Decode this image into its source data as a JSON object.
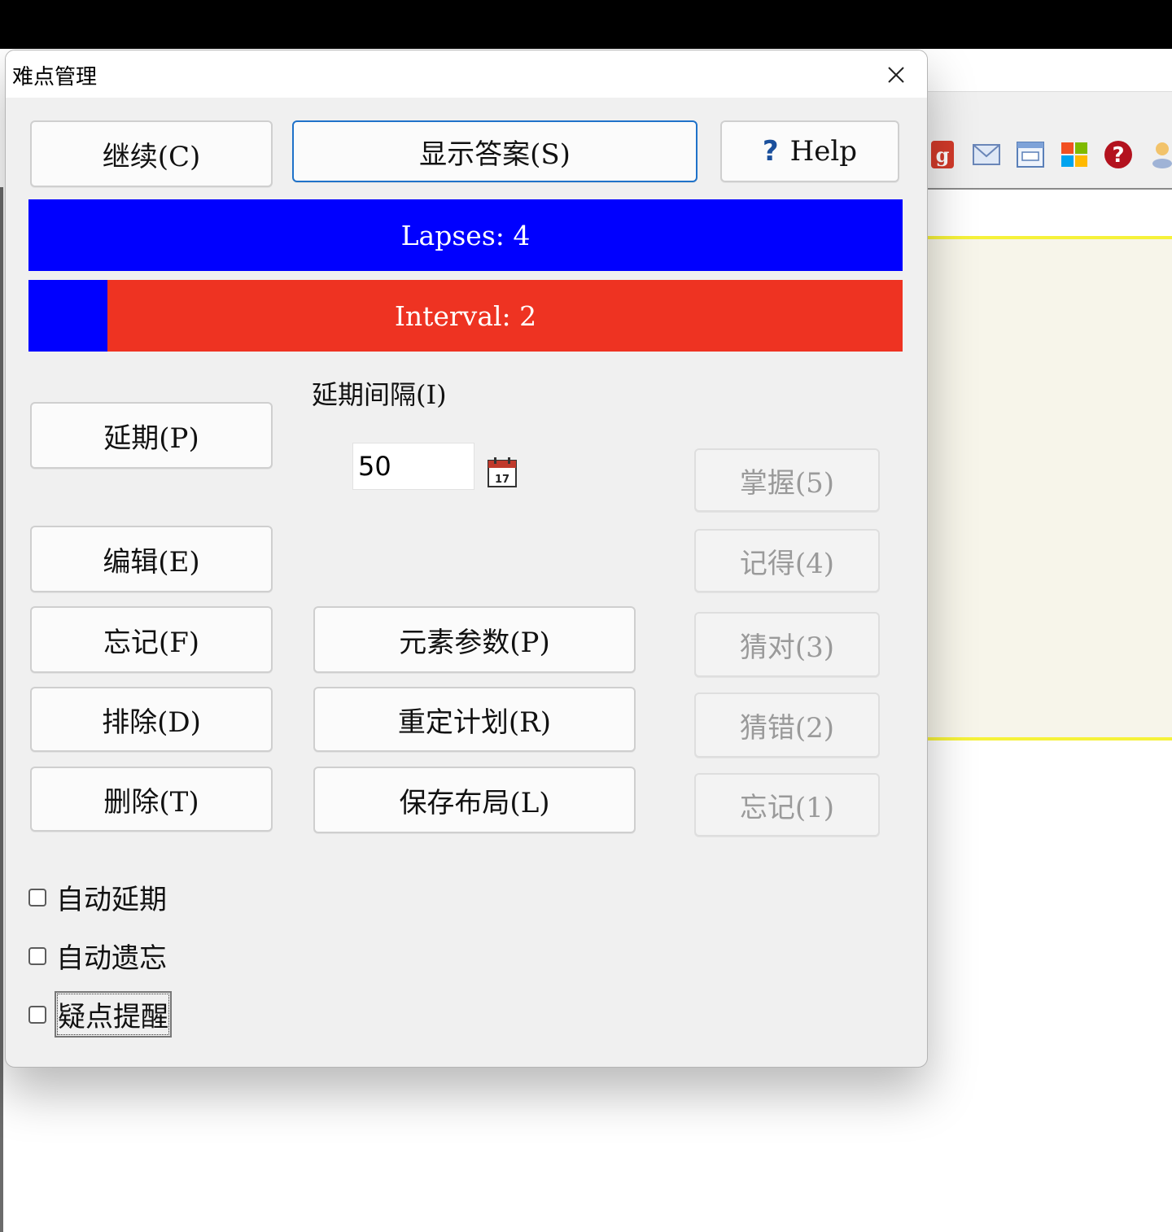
{
  "background": {
    "toolbar_icons": [
      "google-icon",
      "mail-icon",
      "window-icon",
      "windows-logo-icon",
      "help-icon",
      "user-icon"
    ]
  },
  "dialog": {
    "title": "难点管理",
    "buttons": {
      "continue": "继续(C)",
      "show_answer": "显示答案(S)",
      "help": "Help",
      "postpone": "延期(P)",
      "edit": "编辑(E)",
      "forget": "忘记(F)",
      "dismiss": "排除(D)",
      "delete": "删除(T)",
      "element_params": "元素参数(P)",
      "reschedule": "重定计划(R)",
      "save_layout": "保存布局(L)",
      "grade_5": "掌握(5)",
      "grade_4": "记得(4)",
      "grade_3": "猜对(3)",
      "grade_2": "猜错(2)",
      "grade_1": "忘记(1)"
    },
    "lapses_label": "Lapses: 4",
    "interval_label": "Interval: 2",
    "interval_progress": 0.09,
    "postpone_interval_label": "延期间隔(I)",
    "postpone_interval_value": "50",
    "checkboxes": {
      "auto_postpone": "自动延期",
      "auto_forget": "自动遗忘",
      "leech_alert": "疑点提醒"
    },
    "colors": {
      "lapses_bar": "#0000ff",
      "interval_bar": "#ee3322",
      "interval_fill": "#0000ff",
      "primary_border": "#1f72c9"
    }
  }
}
